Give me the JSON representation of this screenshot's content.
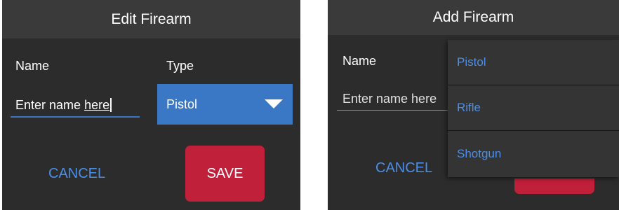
{
  "colors": {
    "panel_background": "#2c2c2c",
    "header_background": "#3a3a3a",
    "accent_blue": "#3a78c5",
    "link_blue": "#4a8fe7",
    "save_red": "#c0203a"
  },
  "edit_dialog": {
    "title": "Edit Firearm",
    "name_label": "Name",
    "type_label": "Type",
    "name_value_start": "Enter name ",
    "name_value_underlined": "here",
    "type_selected": "Pistol",
    "type_icon": "chevron-down-icon",
    "cancel_label": "CANCEL",
    "save_label": "SAVE"
  },
  "add_dialog": {
    "title": "Add Firearm",
    "name_label": "Name",
    "name_placeholder": "Enter name here",
    "cancel_label": "CANCEL",
    "type_options": [
      "Pistol",
      "Rifle",
      "Shotgun"
    ]
  }
}
